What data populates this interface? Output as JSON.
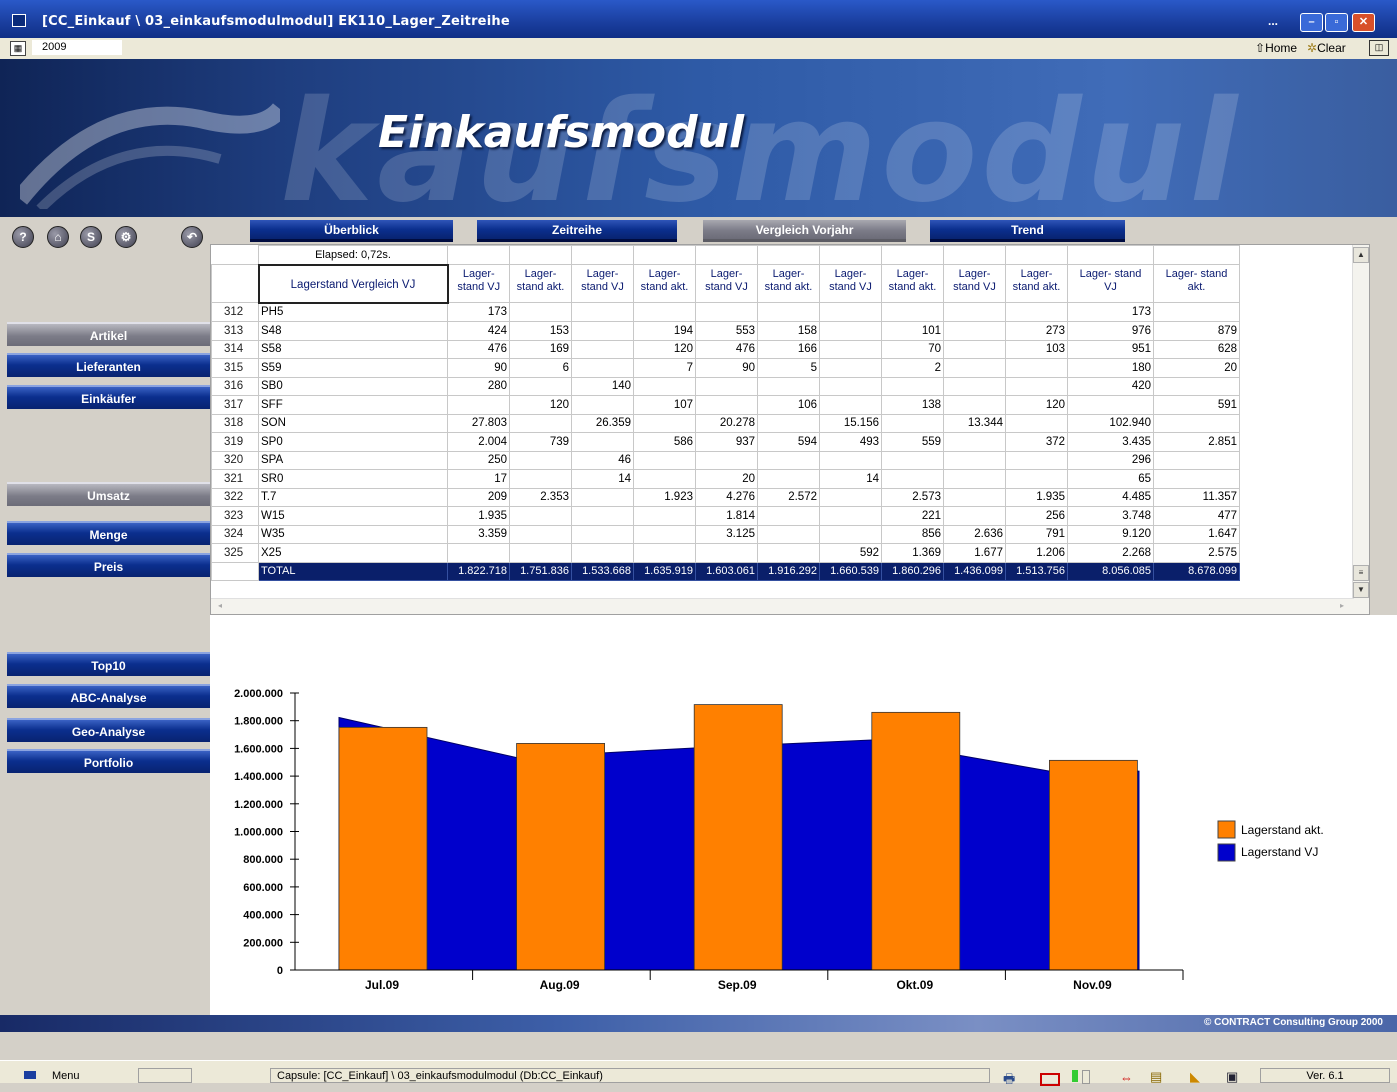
{
  "window": {
    "title": "[CC_Einkauf \\ 03_einkaufsmodulmodul]  EK110_Lager_Zeitreihe",
    "dots": "...",
    "year_value": "2009",
    "home_label": "Home",
    "clear_label": "Clear"
  },
  "banner": {
    "heading": "Einkaufsmodul",
    "bg_text": "kaufsmodul"
  },
  "icons": {
    "help": "?",
    "home": "⌂",
    "s": "S",
    "settings": "⚙",
    "back": "↶"
  },
  "tabs": [
    {
      "label": "Überblick"
    },
    {
      "label": "Zeitreihe"
    },
    {
      "label": "Vergleich Vorjahr"
    },
    {
      "label": "Trend"
    }
  ],
  "nav": {
    "artikel": "Artikel",
    "lieferanten": "Lieferanten",
    "einkaeufer": "Einkäufer",
    "umsatz": "Umsatz",
    "menge": "Menge",
    "preis": "Preis",
    "top10": "Top10",
    "abc": "ABC-Analyse",
    "geo": "Geo-Analyse",
    "portfolio": "Portfolio"
  },
  "grid": {
    "elapsed": "Elapsed: 0,72s.",
    "corner_label": "Lagerstand Vergleich VJ",
    "col_headers": [
      "Lager-\nstand VJ",
      "Lager-\nstand akt.",
      "Lager-\nstand VJ",
      "Lager-\nstand akt.",
      "Lager-\nstand VJ",
      "Lager-\nstand akt.",
      "Lager-\nstand VJ",
      "Lager-\nstand akt.",
      "Lager-\nstand VJ",
      "Lager-\nstand akt.",
      "Lager- stand\nVJ",
      "Lager- stand\nakt."
    ],
    "rows": [
      {
        "n": "312",
        "name": "PH5",
        "v": [
          "173",
          "",
          "",
          "",
          "",
          "",
          "",
          "",
          "",
          "",
          "173",
          ""
        ]
      },
      {
        "n": "313",
        "name": "S48",
        "v": [
          "424",
          "153",
          "",
          "194",
          "553",
          "158",
          "",
          "101",
          "",
          "273",
          "976",
          "879"
        ]
      },
      {
        "n": "314",
        "name": "S58",
        "v": [
          "476",
          "169",
          "",
          "120",
          "476",
          "166",
          "",
          "70",
          "",
          "103",
          "951",
          "628"
        ]
      },
      {
        "n": "315",
        "name": "S59",
        "v": [
          "90",
          "6",
          "",
          "7",
          "90",
          "5",
          "",
          "2",
          "",
          "",
          "180",
          "20"
        ]
      },
      {
        "n": "316",
        "name": "SB0",
        "v": [
          "280",
          "",
          "140",
          "",
          "",
          "",
          "",
          "",
          "",
          "",
          "420",
          ""
        ]
      },
      {
        "n": "317",
        "name": "SFF",
        "v": [
          "",
          "120",
          "",
          "107",
          "",
          "106",
          "",
          "138",
          "",
          "120",
          "",
          "591"
        ]
      },
      {
        "n": "318",
        "name": "SON",
        "v": [
          "27.803",
          "",
          "26.359",
          "",
          "20.278",
          "",
          "15.156",
          "",
          "13.344",
          "",
          "102.940",
          ""
        ]
      },
      {
        "n": "319",
        "name": "SP0",
        "v": [
          "2.004",
          "739",
          "",
          "586",
          "937",
          "594",
          "493",
          "559",
          "",
          "372",
          "3.435",
          "2.851"
        ]
      },
      {
        "n": "320",
        "name": "SPA",
        "v": [
          "250",
          "",
          "46",
          "",
          "",
          "",
          "",
          "",
          "",
          "",
          "296",
          ""
        ]
      },
      {
        "n": "321",
        "name": "SR0",
        "v": [
          "17",
          "",
          "14",
          "",
          "20",
          "",
          "14",
          "",
          "",
          "",
          "65",
          ""
        ]
      },
      {
        "n": "322",
        "name": "T.7",
        "v": [
          "209",
          "2.353",
          "",
          "1.923",
          "4.276",
          "2.572",
          "",
          "2.573",
          "",
          "1.935",
          "4.485",
          "11.357"
        ]
      },
      {
        "n": "323",
        "name": "W15",
        "v": [
          "1.935",
          "",
          "",
          "",
          "1.814",
          "",
          "",
          "221",
          "",
          "256",
          "3.748",
          "477"
        ]
      },
      {
        "n": "324",
        "name": "W35",
        "v": [
          "3.359",
          "",
          "",
          "",
          "3.125",
          "",
          "",
          "856",
          "2.636",
          "791",
          "9.120",
          "1.647"
        ]
      },
      {
        "n": "325",
        "name": "X25",
        "v": [
          "",
          "",
          "",
          "",
          "",
          "",
          "592",
          "1.369",
          "1.677",
          "1.206",
          "2.268",
          "2.575"
        ]
      }
    ],
    "total": {
      "name": "TOTAL",
      "v": [
        "1.822.718",
        "1.751.836",
        "1.533.668",
        "1.635.919",
        "1.603.061",
        "1.916.292",
        "1.660.539",
        "1.860.296",
        "1.436.099",
        "1.513.756",
        "8.056.085",
        "8.678.099"
      ]
    }
  },
  "chart_data": {
    "type": "bar",
    "categories": [
      "Jul.09",
      "Aug.09",
      "Sep.09",
      "Okt.09",
      "Nov.09"
    ],
    "series": [
      {
        "name": "Lagerstand akt.",
        "type": "bar",
        "color": "#ff8000",
        "values": [
          1751836,
          1635919,
          1916292,
          1860296,
          1513756
        ]
      },
      {
        "name": "Lagerstand VJ",
        "type": "area",
        "color": "#0000cc",
        "values": [
          1822718,
          1533668,
          1603061,
          1660539,
          1436099
        ]
      }
    ],
    "yticks": [
      "2.000.000",
      "1.800.000",
      "1.600.000",
      "1.400.000",
      "1.200.000",
      "1.000.000",
      "800.000",
      "600.000",
      "400.000",
      "200.000",
      "0"
    ],
    "ylim": [
      0,
      2000000
    ],
    "legend_position": "right"
  },
  "footer": {
    "copyright": "© CONTRACT Consulting Group 2000",
    "menu_label": "Menu",
    "capsule": "Capsule:  [CC_Einkauf] \\ 03_einkaufsmodulmodul  (Db:CC_Einkauf)",
    "version": "Ver. 6.1"
  }
}
